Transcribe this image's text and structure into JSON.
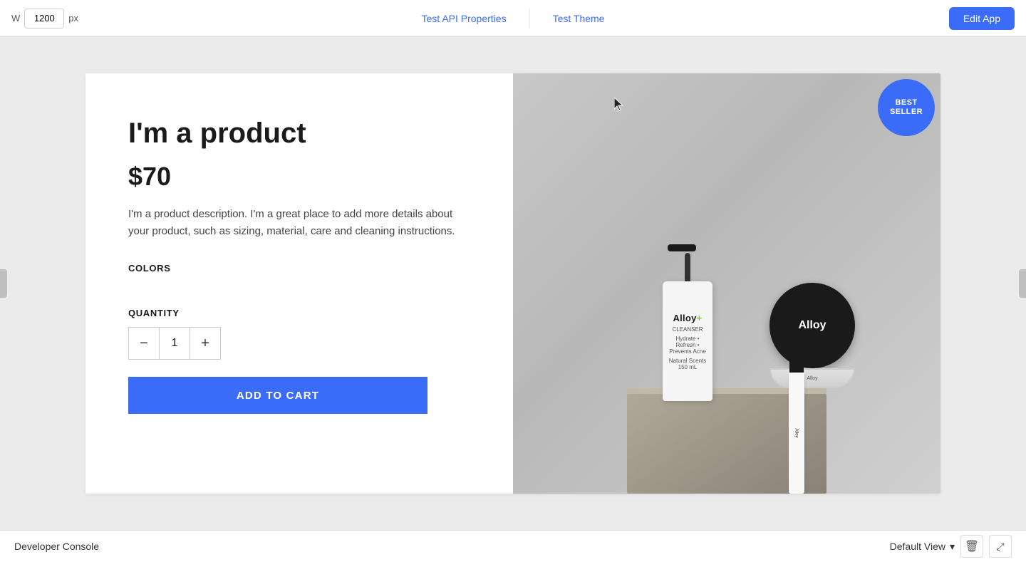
{
  "topbar": {
    "width_label": "W",
    "width_value": "1200",
    "width_unit": "px",
    "tab_api": "Test API Properties",
    "tab_theme": "Test Theme",
    "edit_app_label": "Edit App"
  },
  "product": {
    "title": "I'm a product",
    "price": "$70",
    "description": "I'm a product description. I'm a great place to add more details about your product, such as sizing, material, care and cleaning instructions.",
    "colors_label": "COLORS",
    "quantity_label": "QUANTITY",
    "quantity_value": "1",
    "qty_minus": "−",
    "qty_plus": "+",
    "add_to_cart": "ADD TO CART",
    "badge_line1": "BEST",
    "badge_line2": "SELLER"
  },
  "bottles": {
    "cleanser_brand": "Alloy",
    "cleanser_type": "CLEANSER",
    "cleanser_detail": "Hydrate • Refresh • Prevents Acne",
    "cleanser_volume": "Natural Scents  150 mL",
    "tin_brand": "Alloy",
    "tin_side_text": "Alloy",
    "mascara_label": "Alloy"
  },
  "bottom": {
    "developer_console": "Developer Console",
    "default_view": "Default View"
  }
}
